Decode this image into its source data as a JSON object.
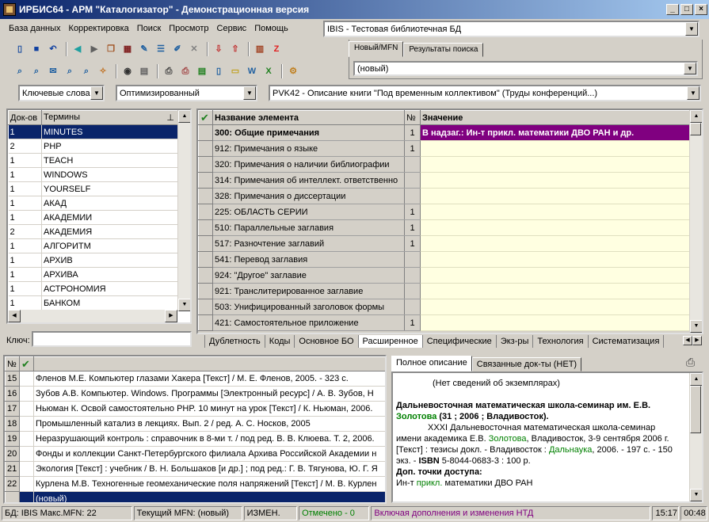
{
  "window": {
    "title": "ИРБИС64 - АРМ \"Каталогизатор\" - Демонстрационная версия",
    "min": "_",
    "max": "□",
    "close": "×"
  },
  "menu": [
    "База данных",
    "Корректировка",
    "Поиск",
    "Просмотр",
    "Сервис",
    "Помощь"
  ],
  "db_select": {
    "value": "IBIS - Тестовая библиотечная БД"
  },
  "right_tabs": [
    "Новый/MFN",
    "Результаты поиска"
  ],
  "mfn_combo": {
    "value": "(новый)"
  },
  "search_bar": {
    "mode": "Ключевые слова",
    "optim": "Оптимизированный",
    "worksheet": "PVK42 - Описание книги \"Под временным коллективом\" (Труды конференций...)"
  },
  "dict": {
    "col_doc": "Док-ов",
    "col_term": "Термины",
    "key_label": "Ключ:",
    "rows": [
      {
        "n": "1",
        "t": "MINUTES"
      },
      {
        "n": "2",
        "t": "PHP"
      },
      {
        "n": "1",
        "t": "TEACH"
      },
      {
        "n": "1",
        "t": "WINDOWS"
      },
      {
        "n": "1",
        "t": "YOURSELF"
      },
      {
        "n": "1",
        "t": "АКАД"
      },
      {
        "n": "1",
        "t": "АКАДЕМИИ"
      },
      {
        "n": "2",
        "t": "АКАДЕМИЯ"
      },
      {
        "n": "1",
        "t": "АЛГОРИТМ"
      },
      {
        "n": "1",
        "t": "АРХИВ"
      },
      {
        "n": "1",
        "t": "АРХИВА"
      },
      {
        "n": "1",
        "t": "АСТРОНОМИЯ"
      },
      {
        "n": "1",
        "t": "БАНКОМ"
      }
    ]
  },
  "editor": {
    "col_name": "Название элемента",
    "col_num": "№",
    "col_value": "Значение",
    "value_row1": "В надзаг.: Ин-т прикл. математики ДВО РАН и др.",
    "rows": [
      {
        "name": "300: Общие примечания",
        "num": "1",
        "bold": true
      },
      {
        "name": "912: Примечания о языке",
        "num": "1"
      },
      {
        "name": "320: Примечания о наличии библиографии",
        "num": ""
      },
      {
        "name": "314: Примечания об интеллект. ответственно",
        "num": ""
      },
      {
        "name": "328: Примечания о диссертации",
        "num": ""
      },
      {
        "name": "225: ОБЛАСТЬ СЕРИИ",
        "num": "1"
      },
      {
        "name": "510: Параллельные заглавия",
        "num": "1"
      },
      {
        "name": "517: Разночтение заглавий",
        "num": "1"
      },
      {
        "name": "541: Перевод заглавия",
        "num": ""
      },
      {
        "name": "924: \"Другое\" заглавие",
        "num": ""
      },
      {
        "name": "921: Транслитерированное заглавие",
        "num": ""
      },
      {
        "name": "503: Унифицированный заголовок формы",
        "num": ""
      },
      {
        "name": "421: Самостоятельное приложение",
        "num": "1"
      }
    ],
    "tabs": [
      "Дублетность",
      "Коды",
      "Основное БО",
      "Расширенное",
      "Специфические",
      "Экз-ры",
      "Технология",
      "Систематизация"
    ]
  },
  "results": {
    "col_n": "№",
    "rows": [
      {
        "n": "15",
        "t": "Фленов М.Е. Компьютер глазами Хакера [Текст] / М. Е. Фленов, 2005. - 323 с."
      },
      {
        "n": "16",
        "t": "Зубов А.В. Компьютер. Windows. Программы [Электронный ресурс] / А. В. Зубов, Н"
      },
      {
        "n": "17",
        "t": "Ньюман К. Освой самостоятельно PHP. 10 минут на урок [Текст] / К. Ньюман, 2006."
      },
      {
        "n": "18",
        "t": "Промышленный катализ в лекциях. Вып. 2 / ред. А. С. Носков, 2005"
      },
      {
        "n": "19",
        "t": "Неразрушающий контроль : справочник в 8-ми т. / под ред. В. В. Клюева. Т. 2, 2006."
      },
      {
        "n": "20",
        "t": "Фонды и коллекции Санкт-Петербургского филиала Архива Российской Академии н"
      },
      {
        "n": "21",
        "t": "Экология [Текст] : учебник / В. Н. Большаков [и др.] ; под ред.: Г. В. Тягунова, Ю. Г. Я"
      },
      {
        "n": "22",
        "t": "Курлена М.В. Техногенные геомеханические поля напряжений [Текст] / М. В. Курлен"
      },
      {
        "n": "",
        "t": "(новый)"
      }
    ]
  },
  "desc": {
    "tabs": [
      "Полное описание",
      "Связанные док-ты (НЕТ)"
    ],
    "line_copies": "(Нет сведений об экземплярах)",
    "h1a": "Дальневосточная математическая школа-семинар им. Е.В.",
    "h1b_green": "Золотова",
    "h1b_rest": " (31 ; 2006 ; Владивосток).",
    "p1a": "XXXI Дальневосточная математическая школа-семинар",
    "p1b": "имени академика Е.В. ",
    "p1b_green": "Золотова",
    "p1b_rest": ", Владивосток, 3-9 сентября 2006 г.",
    "p1c": "[Текст] : тезисы докл. - Владивосток : ",
    "p1c_green": "Дальнаука",
    "p1c_rest": ", 2006. - 197 с. - 150",
    "p1d": "экз. - ",
    "p1d_bold": "ISBN",
    "p1d_rest": " 5-8044-0683-3 : 100 р.",
    "h2": "Доп. точки доступа:",
    "p2a": "Ин-т ",
    "p2_green": "прикл.",
    "p2_rest": " математики ДВО РАН"
  },
  "status": {
    "db": "БД: IBIS Макс.MFN: 22",
    "mfn": "Текущий MFN: (новый)",
    "changed": "ИЗМЕН.",
    "marked": "Отмечено - 0",
    "include": "Включая дополнения и изменения НТД",
    "time1": "15:17",
    "time2": "00:48"
  },
  "colors": {
    "title_start": "#0a246a",
    "selection": "#0a246a",
    "purple": "#800080",
    "value_bg": "#ffffe1"
  }
}
